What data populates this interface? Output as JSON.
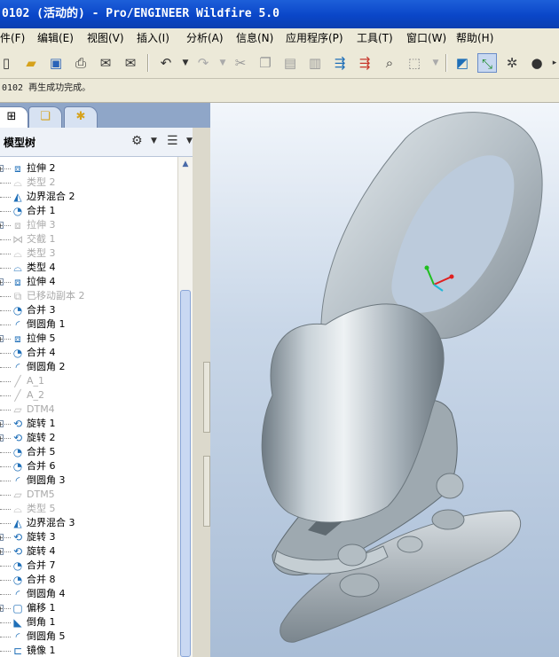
{
  "window": {
    "title": "0102 (活动的) - Pro/ENGINEER Wildfire 5.0"
  },
  "menu": {
    "items": [
      "件(F)",
      "编辑(E)",
      "视图(V)",
      "插入(I)",
      "分析(A)",
      "信息(N)",
      "应用程序(P)",
      "工具(T)",
      "窗口(W)",
      "帮助(H)"
    ]
  },
  "message": {
    "text": "0102 再生成功完成。"
  },
  "nav": {
    "tabs": [
      "model-tree-tab-icon",
      "layer-tab-icon",
      "favorites-tab-icon"
    ]
  },
  "model_tree": {
    "title": "模型树",
    "items": [
      {
        "label": "拉伸 2",
        "icon": "extrude-icon",
        "dim": false,
        "expand": true
      },
      {
        "label": "类型 2",
        "icon": "type-icon",
        "dim": true,
        "expand": false
      },
      {
        "label": "边界混合 2",
        "icon": "boundary-blend-icon",
        "dim": false,
        "expand": false
      },
      {
        "label": "合并 1",
        "icon": "merge-icon",
        "dim": false,
        "expand": false
      },
      {
        "label": "拉伸 3",
        "icon": "extrude-icon",
        "dim": true,
        "expand": true
      },
      {
        "label": "交截 1",
        "icon": "intersect-icon",
        "dim": true,
        "expand": false
      },
      {
        "label": "类型 3",
        "icon": "type-icon",
        "dim": true,
        "expand": false
      },
      {
        "label": "类型 4",
        "icon": "type-icon",
        "dim": false,
        "expand": false
      },
      {
        "label": "拉伸 4",
        "icon": "extrude-icon",
        "dim": false,
        "expand": true
      },
      {
        "label": "已移动副本 2",
        "icon": "copy-icon",
        "dim": true,
        "expand": false
      },
      {
        "label": "合并 3",
        "icon": "merge-icon",
        "dim": false,
        "expand": false
      },
      {
        "label": "倒圆角 1",
        "icon": "round-icon",
        "dim": false,
        "expand": false
      },
      {
        "label": "拉伸 5",
        "icon": "extrude-icon",
        "dim": false,
        "expand": true
      },
      {
        "label": "合并 4",
        "icon": "merge-icon",
        "dim": false,
        "expand": false
      },
      {
        "label": "倒圆角 2",
        "icon": "round-icon",
        "dim": false,
        "expand": false
      },
      {
        "label": "A_1",
        "icon": "axis-icon",
        "dim": true,
        "expand": false
      },
      {
        "label": "A_2",
        "icon": "axis-icon",
        "dim": true,
        "expand": false
      },
      {
        "label": "DTM4",
        "icon": "datum-plane-icon",
        "dim": true,
        "expand": false
      },
      {
        "label": "旋转 1",
        "icon": "revolve-icon",
        "dim": false,
        "expand": true
      },
      {
        "label": "旋转 2",
        "icon": "revolve-icon",
        "dim": false,
        "expand": true
      },
      {
        "label": "合并 5",
        "icon": "merge-icon",
        "dim": false,
        "expand": false
      },
      {
        "label": "合并 6",
        "icon": "merge-icon",
        "dim": false,
        "expand": false
      },
      {
        "label": "倒圆角 3",
        "icon": "round-icon",
        "dim": false,
        "expand": false
      },
      {
        "label": "DTM5",
        "icon": "datum-plane-icon",
        "dim": true,
        "expand": false
      },
      {
        "label": "类型 5",
        "icon": "type-icon",
        "dim": true,
        "expand": false
      },
      {
        "label": "边界混合 3",
        "icon": "boundary-blend-icon",
        "dim": false,
        "expand": false
      },
      {
        "label": "旋转 3",
        "icon": "revolve-icon",
        "dim": false,
        "expand": true
      },
      {
        "label": "旋转 4",
        "icon": "revolve-icon",
        "dim": false,
        "expand": true
      },
      {
        "label": "合并 7",
        "icon": "merge-icon",
        "dim": false,
        "expand": false
      },
      {
        "label": "合并 8",
        "icon": "merge-icon",
        "dim": false,
        "expand": false
      },
      {
        "label": "倒圆角 4",
        "icon": "round-icon",
        "dim": false,
        "expand": false
      },
      {
        "label": "偏移 1",
        "icon": "offset-icon",
        "dim": false,
        "expand": true
      },
      {
        "label": "倒角 1",
        "icon": "chamfer-icon",
        "dim": false,
        "expand": false
      },
      {
        "label": "倒圆角 5",
        "icon": "round-icon",
        "dim": false,
        "expand": false
      },
      {
        "label": "镜像 1",
        "icon": "mirror-icon",
        "dim": false,
        "expand": false
      }
    ]
  },
  "colors": {
    "title_bar": "#0a46c8",
    "menu_bg": "#ece9d8",
    "viewport_top": "#f2f6fb",
    "viewport_bottom": "#a9bdd6",
    "model_shade": "#9aa6ad"
  }
}
